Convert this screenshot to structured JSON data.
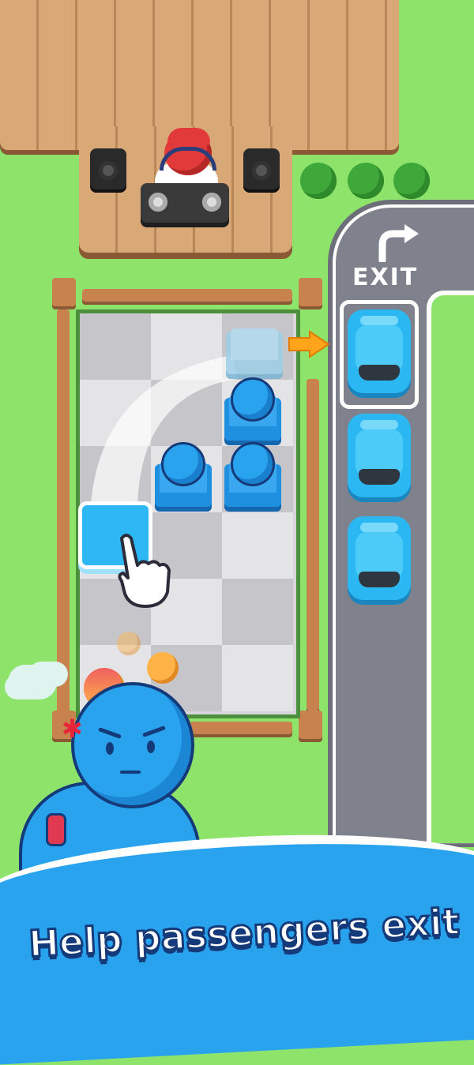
{
  "road": {
    "exit_label": "EXIT"
  },
  "banner": {
    "text": "Help passengers exit !"
  },
  "icons": {
    "exit_arrow": "curved-arrow-right-icon",
    "move_arrow": "orange-arrow-right-icon",
    "tap_hand": "pointing-hand-icon",
    "angry_faces": "angry-face-icon",
    "watch": "wristwatch-icon"
  },
  "colors": {
    "grass": "#8ee46a",
    "road": "#7f828c",
    "car": "#2bb8f2",
    "seat": "#1f8fe0",
    "banner": "#2aa3ee"
  },
  "board": {
    "columns": 3,
    "rows": 6,
    "occupied_seats": 3,
    "empty_seats": 1,
    "selected_seat": 1
  },
  "cars_waiting": 3
}
